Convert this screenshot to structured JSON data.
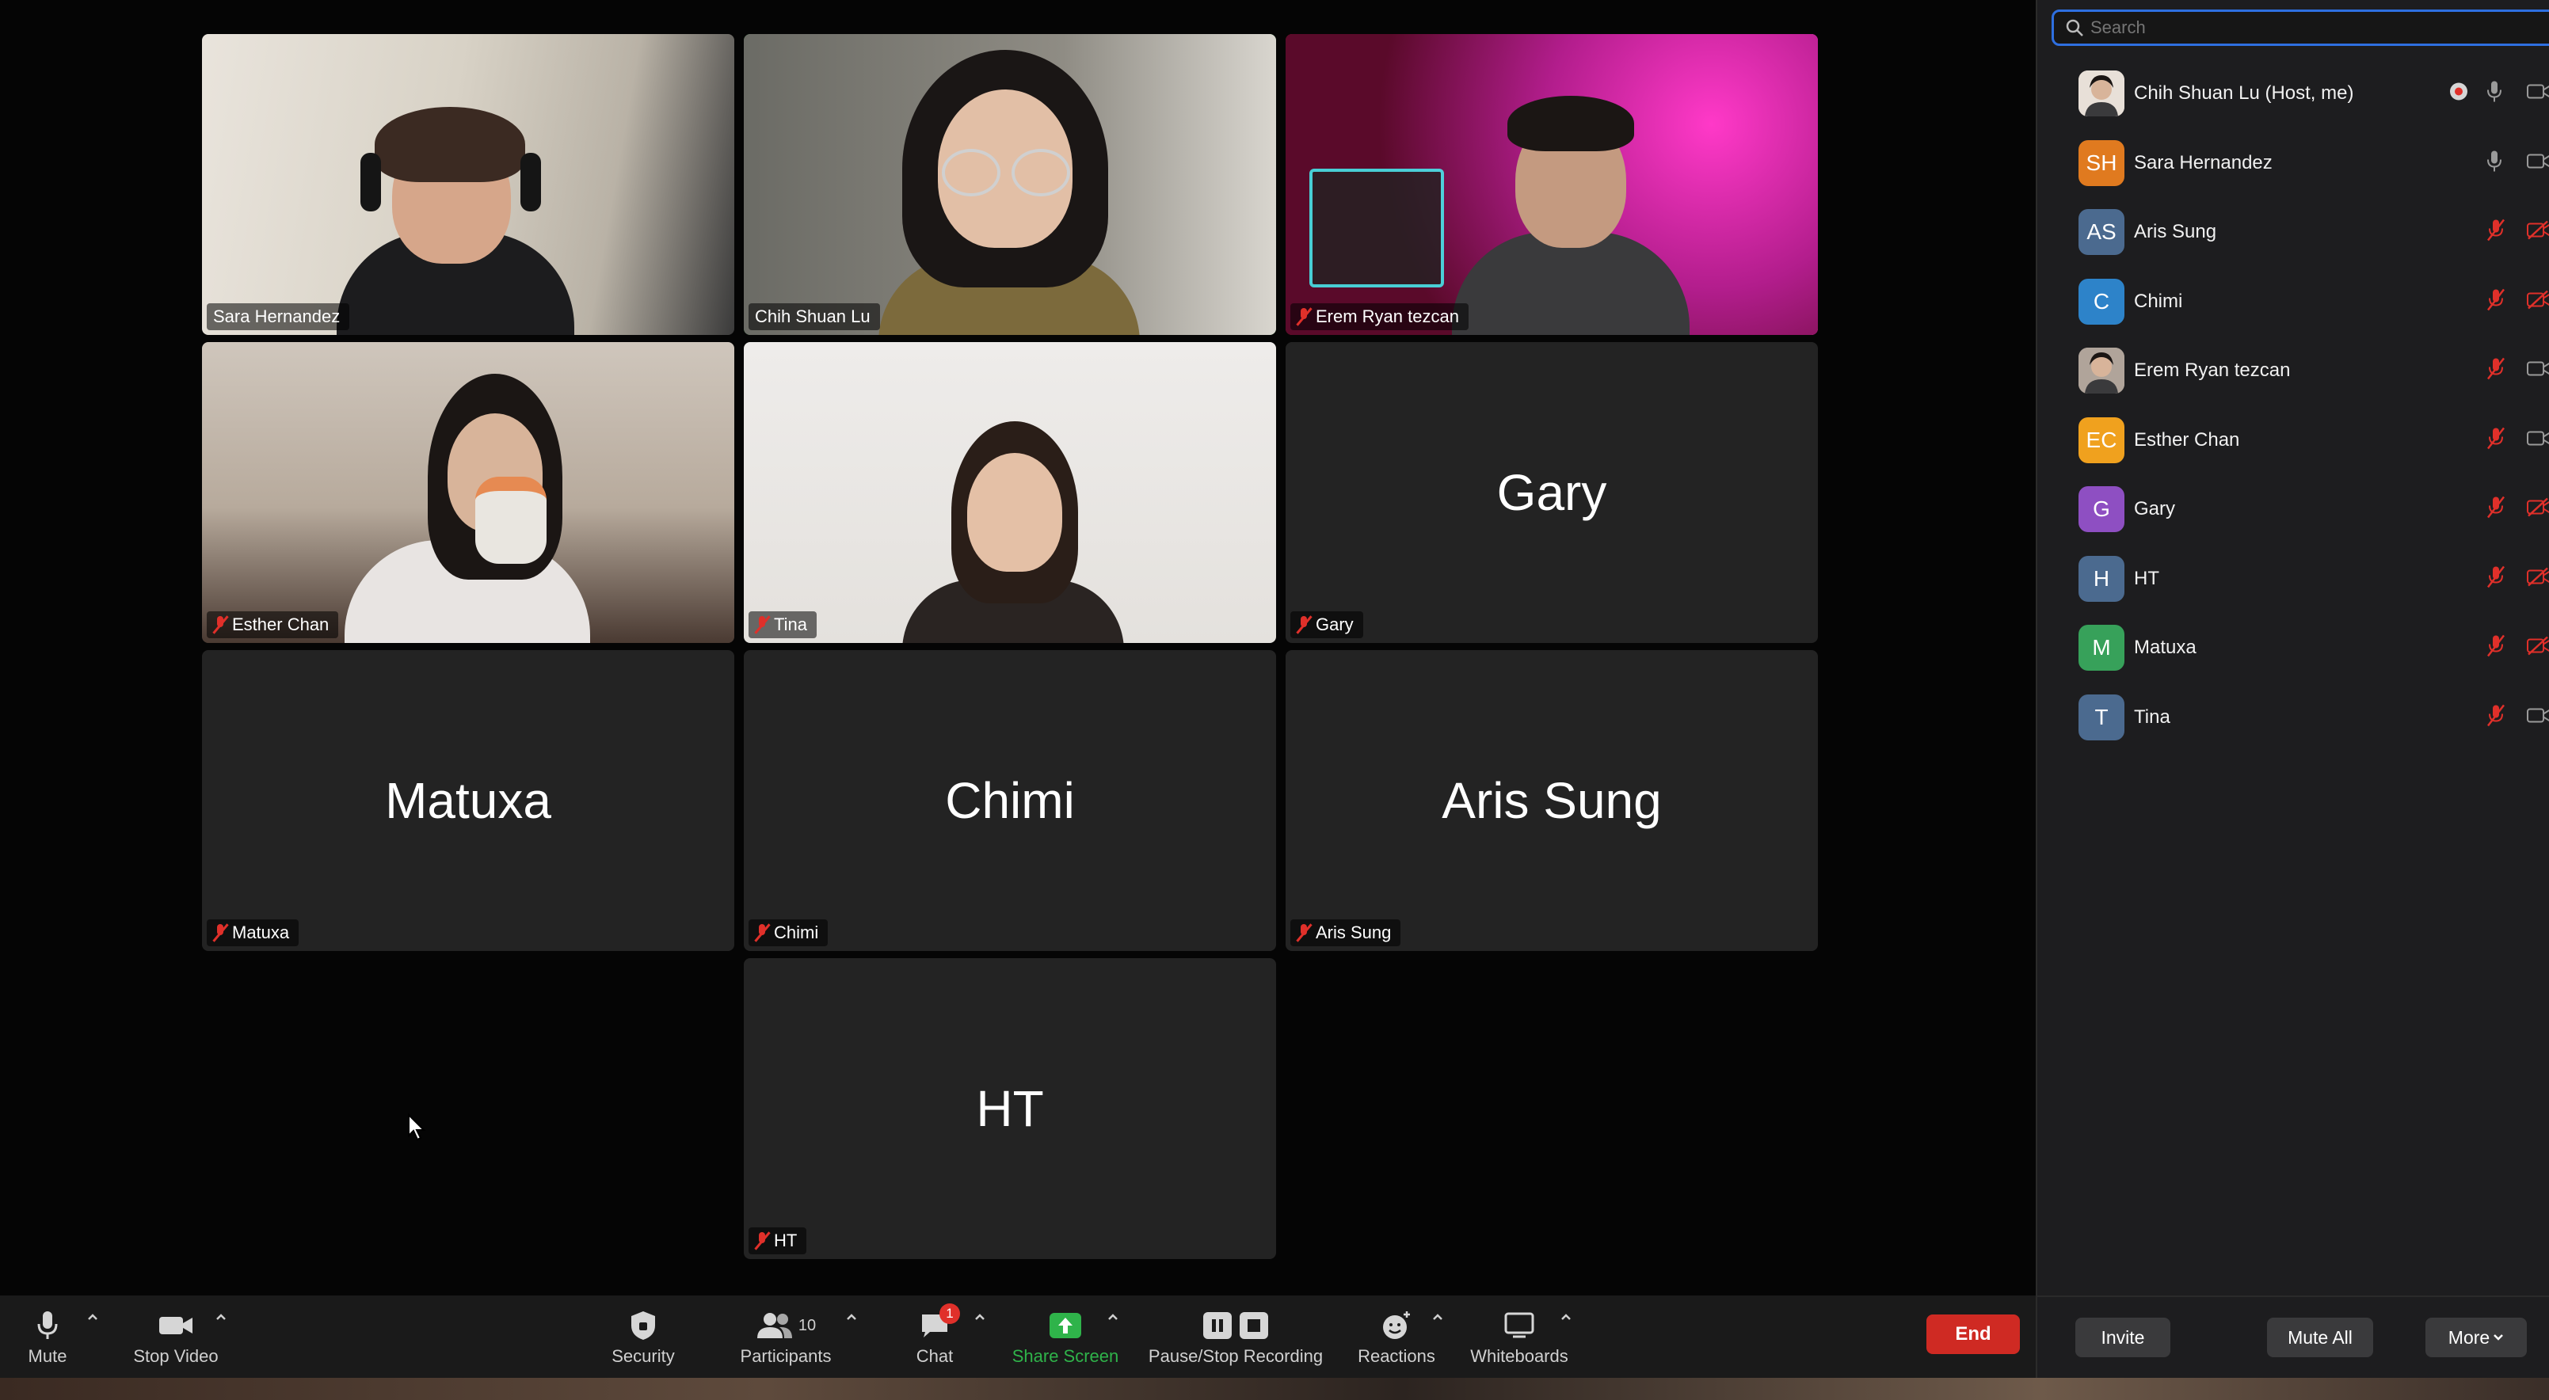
{
  "tiles": [
    {
      "id": "sara",
      "name": "Sara Hernandez",
      "type": "video",
      "muted": false,
      "active": false
    },
    {
      "id": "chih",
      "name": "Chih Shuan Lu",
      "type": "video",
      "muted": false,
      "active": true
    },
    {
      "id": "erem",
      "name": "Erem Ryan tezcan",
      "type": "video",
      "muted": true,
      "active": false
    },
    {
      "id": "esther",
      "name": "Esther Chan",
      "type": "video",
      "muted": true,
      "active": false
    },
    {
      "id": "tina",
      "name": "Tina",
      "type": "video",
      "muted": true,
      "active": false
    },
    {
      "id": "gary",
      "name": "Gary",
      "big_name": "Gary",
      "type": "name",
      "muted": true,
      "active": false
    },
    {
      "id": "matuxa",
      "name": "Matuxa",
      "big_name": "Matuxa",
      "type": "name",
      "muted": true,
      "active": false
    },
    {
      "id": "chimi",
      "name": "Chimi",
      "big_name": "Chimi",
      "type": "name",
      "muted": true,
      "active": false
    },
    {
      "id": "aris",
      "name": "Aris Sung",
      "big_name": "Aris Sung",
      "type": "name",
      "muted": true,
      "active": false
    },
    {
      "id": "ht",
      "name": "HT",
      "big_name": "HT",
      "type": "name",
      "muted": true,
      "active": false
    }
  ],
  "toolbar": {
    "mute": "Mute",
    "stop_video": "Stop Video",
    "security": "Security",
    "participants": "Participants",
    "participants_count": "10",
    "chat": "Chat",
    "chat_badge": "1",
    "share_screen": "Share Screen",
    "recording": "Pause/Stop Recording",
    "reactions": "Reactions",
    "whiteboards": "Whiteboards",
    "end": "End"
  },
  "panel": {
    "search_placeholder": "Search",
    "participants": [
      {
        "name": "Chih Shuan Lu (Host, me)",
        "initials": "",
        "color": "#e8e0d8",
        "avatar": "photo",
        "mic": "on",
        "video": "on",
        "recording": true
      },
      {
        "name": "Sara Hernandez",
        "initials": "SH",
        "color": "#e07a1f",
        "avatar": "initials",
        "mic": "on",
        "video": "on"
      },
      {
        "name": "Aris Sung",
        "initials": "AS",
        "color": "#4b6a8f",
        "avatar": "initials",
        "mic": "off",
        "video": "off"
      },
      {
        "name": "Chimi",
        "initials": "C",
        "color": "#2d83c9",
        "avatar": "initials",
        "mic": "off",
        "video": "off"
      },
      {
        "name": "Erem Ryan tezcan",
        "initials": "",
        "color": "#b0a49a",
        "avatar": "photo",
        "mic": "off",
        "video": "on"
      },
      {
        "name": "Esther Chan",
        "initials": "EC",
        "color": "#f0a11e",
        "avatar": "initials",
        "mic": "off",
        "video": "on"
      },
      {
        "name": "Gary",
        "initials": "G",
        "color": "#8e4fc2",
        "avatar": "initials",
        "mic": "off",
        "video": "off"
      },
      {
        "name": "HT",
        "initials": "H",
        "color": "#4b6a8f",
        "avatar": "initials",
        "mic": "off",
        "video": "off"
      },
      {
        "name": "Matuxa",
        "initials": "M",
        "color": "#37a15a",
        "avatar": "initials",
        "mic": "off",
        "video": "off"
      },
      {
        "name": "Tina",
        "initials": "T",
        "color": "#4b6a8f",
        "avatar": "initials",
        "mic": "off",
        "video": "on"
      }
    ],
    "invite": "Invite",
    "mute_all": "Mute All",
    "more": "More"
  },
  "colors": {
    "active_speaker": "#2fb34a",
    "muted_red": "#e0302a",
    "end_red": "#cf2a23",
    "search_focus": "#2e6fe0",
    "share_green": "#2fb34a"
  }
}
